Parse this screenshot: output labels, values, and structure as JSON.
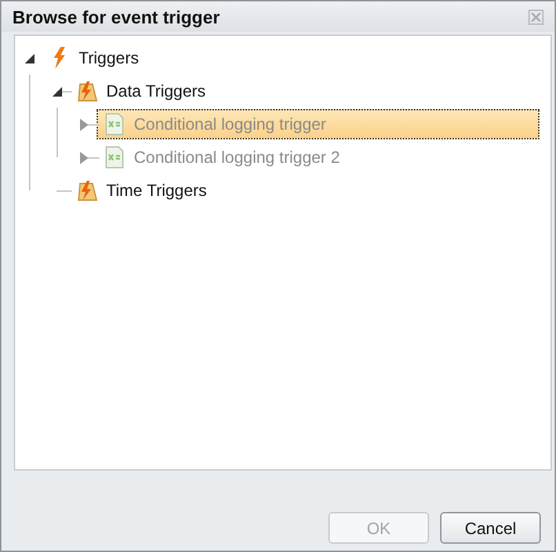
{
  "window": {
    "title": "Browse for event trigger"
  },
  "tree": [
    {
      "label": "Triggers",
      "kind": "root",
      "expandable": true,
      "expanded": true,
      "selected": false,
      "disabled": false,
      "children": [
        {
          "label": "Data Triggers",
          "kind": "folder",
          "expandable": true,
          "expanded": true,
          "selected": false,
          "disabled": false,
          "children": [
            {
              "label": "Conditional logging trigger",
              "kind": "item",
              "expandable": true,
              "expanded": false,
              "selected": true,
              "disabled": true
            },
            {
              "label": "Conditional logging trigger 2",
              "kind": "item",
              "expandable": true,
              "expanded": false,
              "selected": false,
              "disabled": true
            }
          ]
        },
        {
          "label": "Time Triggers",
          "kind": "folder",
          "expandable": false,
          "selected": false,
          "disabled": false
        }
      ]
    }
  ],
  "buttons": [
    {
      "label": "OK",
      "disabled": true
    },
    {
      "label": "Cancel",
      "disabled": false
    }
  ]
}
